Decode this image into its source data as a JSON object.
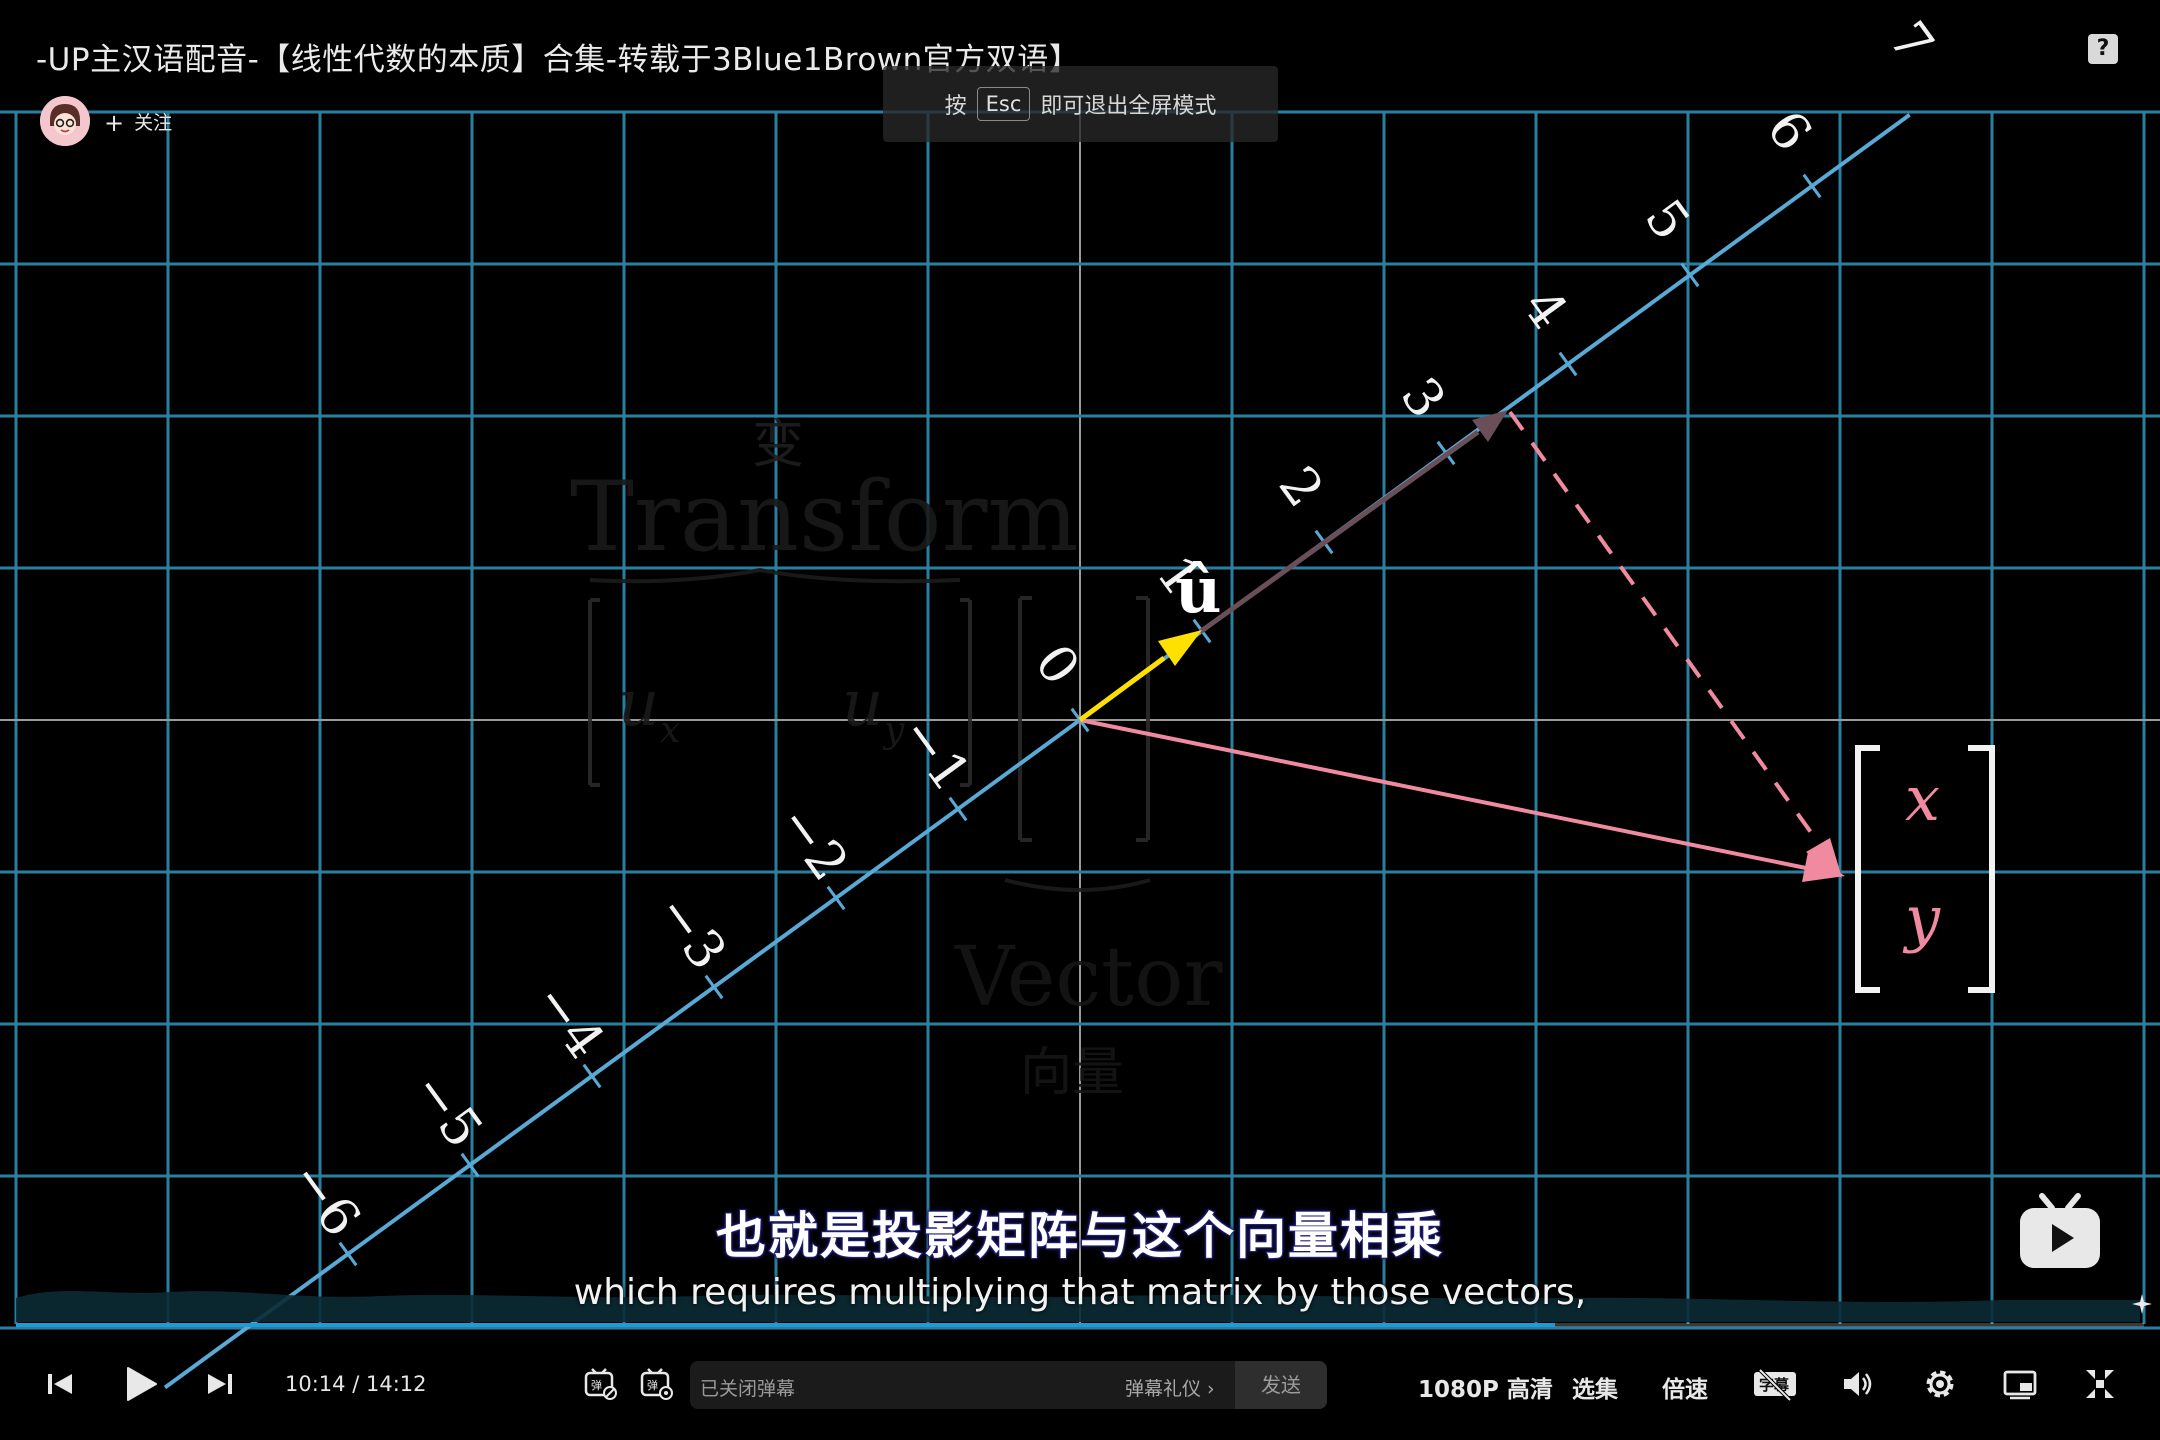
{
  "video": {
    "title": "-UP主汉语配音-【线性代数的本质】合集-转载于3Blue1Brown官方双语】",
    "follow_label": "关注",
    "esc_hint": {
      "before": "按",
      "key": "Esc",
      "after": "即可退出全屏模式"
    },
    "subtitle_cn": "也就是投影矩阵与这个向量相乘",
    "subtitle_en": "which requires multiplying that matrix by those vectors,",
    "progress_fraction": 0.7233
  },
  "scene": {
    "number_line_labels": [
      "−6",
      "−5",
      "−4",
      "−3",
      "−2",
      "−1",
      "0",
      "1",
      "2",
      "3",
      "4",
      "5",
      "6",
      "7"
    ],
    "unit_vector_label": "û",
    "vector_entries": [
      "x",
      "y"
    ],
    "faded_text": {
      "top_cn": "变",
      "transform": "Transform",
      "matrix_entries": [
        "u",
        "u"
      ],
      "matrix_subscripts": [
        "x",
        "y"
      ],
      "vector_word": "Vector",
      "vector_cn": "向量"
    },
    "colors": {
      "grid": "#2a7fa1",
      "axis": "#9a9a9a",
      "number_line": "#58a9d6",
      "unit_vector": "#ffe000",
      "projection_arrow": "#6b4f58",
      "vector": "#f08aa0"
    }
  },
  "controls": {
    "time_current": "10:14",
    "time_separator": "/",
    "time_total": "14:12",
    "danmu_placeholder": "已关闭弹幕",
    "danmu_etiquette": "弹幕礼仪 ›",
    "danmu_send": "发送",
    "quality": "1080P 高清",
    "episodes": "选集",
    "speed": "倍速",
    "icons": [
      "prev-icon",
      "play-icon",
      "next-icon",
      "danmu-toggle-icon",
      "danmu-settings-icon",
      "subtitle-icon",
      "volume-icon",
      "settings-icon",
      "pip-icon",
      "fullscreen-exit-icon"
    ]
  }
}
